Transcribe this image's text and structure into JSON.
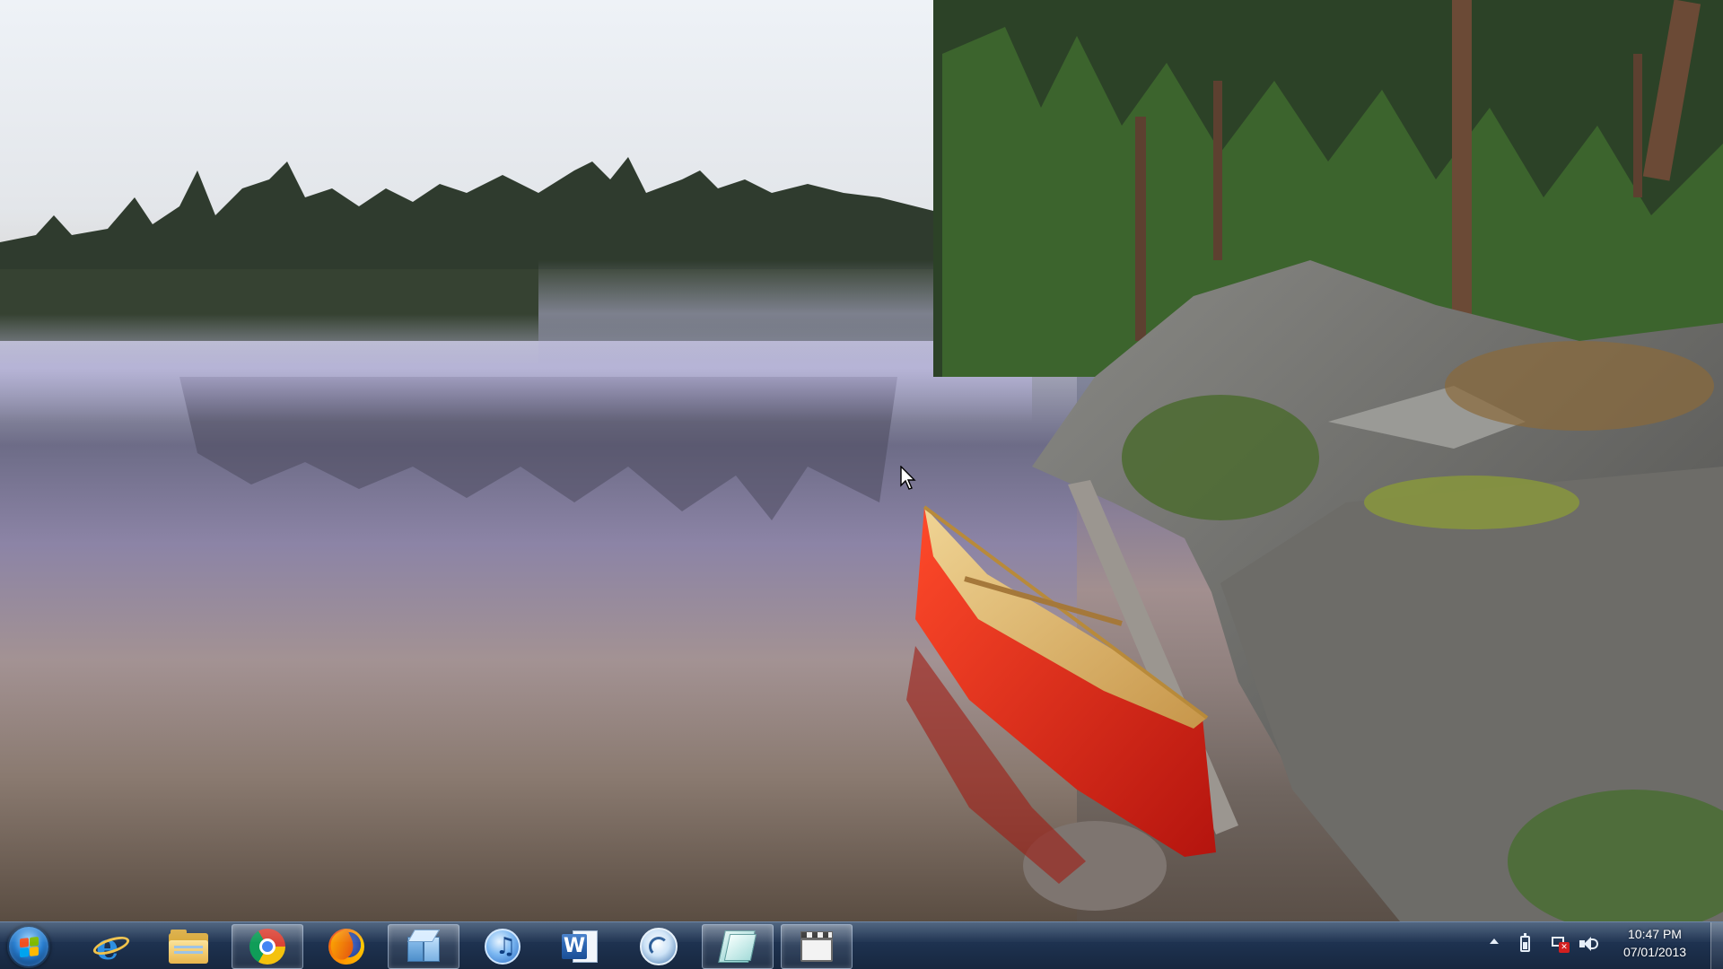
{
  "desktop": {
    "wallpaper": "lake-canoe-forest-landscape"
  },
  "taskbar": {
    "start_button": {
      "icon": "windows-logo-icon"
    },
    "pinned": [
      {
        "name": "internet-explorer",
        "icon": "internet-explorer-icon",
        "active": false
      },
      {
        "name": "windows-explorer",
        "icon": "folder-icon",
        "active": false
      },
      {
        "name": "google-chrome",
        "icon": "chrome-icon",
        "active": true
      },
      {
        "name": "firefox",
        "icon": "firefox-icon",
        "active": false
      },
      {
        "name": "virtual-box",
        "icon": "cube-icon",
        "active": true
      },
      {
        "name": "itunes",
        "icon": "itunes-icon",
        "active": false
      },
      {
        "name": "microsoft-word",
        "icon": "word-icon",
        "active": false
      },
      {
        "name": "communicator",
        "icon": "communicator-icon",
        "active": false
      },
      {
        "name": "sheets-app",
        "icon": "sheet-icon",
        "active": true
      },
      {
        "name": "video-app",
        "icon": "clapperboard-icon",
        "active": true
      }
    ],
    "tray": {
      "icons": [
        "show-hidden-icons-icon",
        "battery-icon",
        "network-disconnected-icon",
        "volume-icon"
      ],
      "time": "10:47 PM",
      "date": "07/01/2013"
    }
  },
  "colors": {
    "taskbar": "#1f3453",
    "canoe_hull": "#e0291c",
    "canoe_interior": "#d8b36a"
  }
}
